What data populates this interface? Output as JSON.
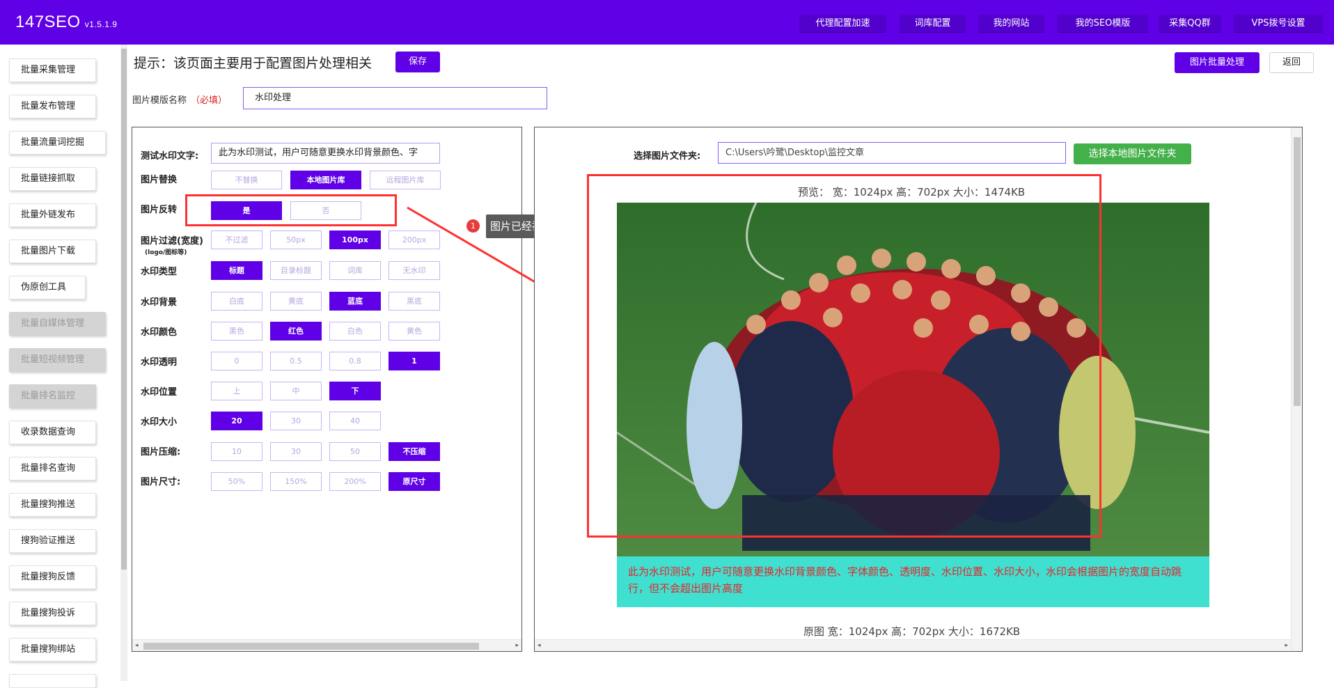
{
  "app": {
    "name": "147SEO",
    "version": "v1.5.1.9"
  },
  "nav": [
    {
      "label": "代理配置加速"
    },
    {
      "label": "词库配置"
    },
    {
      "label": "我的网站"
    },
    {
      "label": "我的SEO模版"
    },
    {
      "label": "采集QQ群"
    },
    {
      "label": "VPS拨号设置"
    }
  ],
  "sidebar": {
    "items": [
      {
        "label": "批量采集管理",
        "disabled": false
      },
      {
        "label": "批量发布管理",
        "disabled": false
      },
      {
        "label": "批量流量词挖掘",
        "disabled": false
      },
      {
        "label": "批量链接抓取",
        "disabled": false
      },
      {
        "label": "批量外链发布",
        "disabled": false
      },
      {
        "label": "批量图片下载",
        "disabled": false
      },
      {
        "label": "伪原创工具",
        "disabled": false
      },
      {
        "label": "批量自媒体管理",
        "disabled": true
      },
      {
        "label": "批量短视频管理",
        "disabled": true
      },
      {
        "label": "批量排名监控",
        "disabled": true
      },
      {
        "label": "收录数据查询",
        "disabled": false
      },
      {
        "label": "批量排名查询",
        "disabled": false
      },
      {
        "label": "批量搜狗推送",
        "disabled": false
      },
      {
        "label": "搜狗验证推送",
        "disabled": false
      },
      {
        "label": "批量搜狗反馈",
        "disabled": false
      },
      {
        "label": "批量搜狗投诉",
        "disabled": false
      },
      {
        "label": "批量搜狗绑站",
        "disabled": false
      }
    ]
  },
  "top": {
    "hint": "提示：该页面主要用于配置图片处理相关",
    "save_label": "保存",
    "batch_label": "图片批量处理",
    "back_label": "返回",
    "template_label": "图片模版名称",
    "template_required": "（必填）",
    "template_value": "水印处理"
  },
  "left": {
    "watermark_text_label": "测试水印文字:",
    "watermark_text_value": "此为水印测试，用户可随意更换水印背景颜色、字",
    "rows": [
      {
        "label": "图片替换",
        "options": [
          {
            "label": "不替换",
            "selected": false
          },
          {
            "label": "本地图片库",
            "selected": true
          },
          {
            "label": "远程图片库",
            "selected": false
          }
        ]
      },
      {
        "label": "图片反转",
        "options": [
          {
            "label": "是",
            "selected": true
          },
          {
            "label": "否",
            "selected": false
          }
        ]
      },
      {
        "label": "图片过滤(宽度)",
        "sub": "(logo/图标等)",
        "options": [
          {
            "label": "不过滤",
            "selected": false
          },
          {
            "label": "50px",
            "selected": false
          },
          {
            "label": "100px",
            "selected": true
          },
          {
            "label": "200px",
            "selected": false
          }
        ]
      },
      {
        "label": "水印类型",
        "options": [
          {
            "label": "标题",
            "selected": true
          },
          {
            "label": "目录标题",
            "selected": false
          },
          {
            "label": "词库",
            "selected": false
          },
          {
            "label": "无水印",
            "selected": false
          }
        ]
      },
      {
        "label": "水印背景",
        "options": [
          {
            "label": "白底",
            "selected": false
          },
          {
            "label": "黄底",
            "selected": false
          },
          {
            "label": "蓝底",
            "selected": true
          },
          {
            "label": "黑底",
            "selected": false
          }
        ]
      },
      {
        "label": "水印颜色",
        "options": [
          {
            "label": "黑色",
            "selected": false
          },
          {
            "label": "红色",
            "selected": true
          },
          {
            "label": "白色",
            "selected": false
          },
          {
            "label": "黄色",
            "selected": false
          }
        ]
      },
      {
        "label": "水印透明",
        "options": [
          {
            "label": "0",
            "selected": false
          },
          {
            "label": "0.5",
            "selected": false
          },
          {
            "label": "0.8",
            "selected": false
          },
          {
            "label": "1",
            "selected": true
          }
        ]
      },
      {
        "label": "水印位置",
        "options": [
          {
            "label": "上",
            "selected": false
          },
          {
            "label": "中",
            "selected": false
          },
          {
            "label": "下",
            "selected": true
          }
        ]
      },
      {
        "label": "水印大小",
        "options": [
          {
            "label": "20",
            "selected": true
          },
          {
            "label": "30",
            "selected": false
          },
          {
            "label": "40",
            "selected": false
          }
        ]
      },
      {
        "label": "图片压缩:",
        "options": [
          {
            "label": "10",
            "selected": false
          },
          {
            "label": "30",
            "selected": false
          },
          {
            "label": "50",
            "selected": false
          },
          {
            "label": "不压缩",
            "selected": true
          }
        ]
      },
      {
        "label": "图片尺寸:",
        "options": [
          {
            "label": "50%",
            "selected": false
          },
          {
            "label": "150%",
            "selected": false
          },
          {
            "label": "200%",
            "selected": false
          },
          {
            "label": "原尺寸",
            "selected": true
          }
        ]
      }
    ]
  },
  "right": {
    "folder_label": "选择图片文件夹:",
    "folder_value": "C:\\Users\\吟鹭\\Desktop\\监控文章",
    "folder_button": "选择本地图片文件夹",
    "preview_info": "预览：  宽：1024px 高：702px 大小：1474KB",
    "original_info": "原图  宽：1024px 高：702px 大小：1672KB",
    "watermark_band_text": "此为水印测试，用户可随意更换水印背景颜色、字体颜色、透明度、水印位置、水印大小，水印会根据图片的宽度自动跳行，但不会超出图片高度"
  },
  "annotation": {
    "badge": "1",
    "tooltip": "图片已经被反转"
  },
  "colors": {
    "brand": "#5f00e6",
    "green": "#43b049",
    "highlight": "#ff3030",
    "watermark_bg": "#3fe0d0",
    "watermark_fg": "#e8242a"
  }
}
